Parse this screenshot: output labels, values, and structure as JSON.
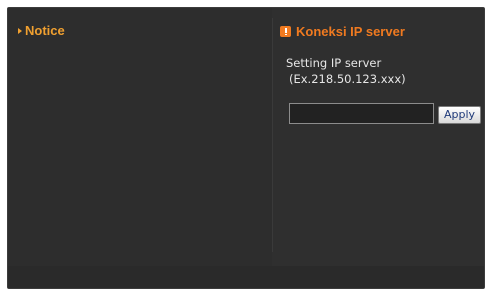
{
  "left_panel": {
    "notice_label": "Notice"
  },
  "ip_server": {
    "title": "Koneksi IP server",
    "setting_label": "Setting IP server",
    "example_label": "(Ex.218.50.123.xxx)",
    "input_value": "",
    "apply_label": "Apply"
  },
  "icons": {
    "notice_arrow": "chevron-right-icon",
    "title_icon": "info-icon"
  },
  "colors": {
    "background": "#2f2f2f",
    "notice_text": "#f0a030",
    "title_text": "#f07a20",
    "body_text": "#e6e6e6",
    "button_text": "#1f3a7a"
  }
}
